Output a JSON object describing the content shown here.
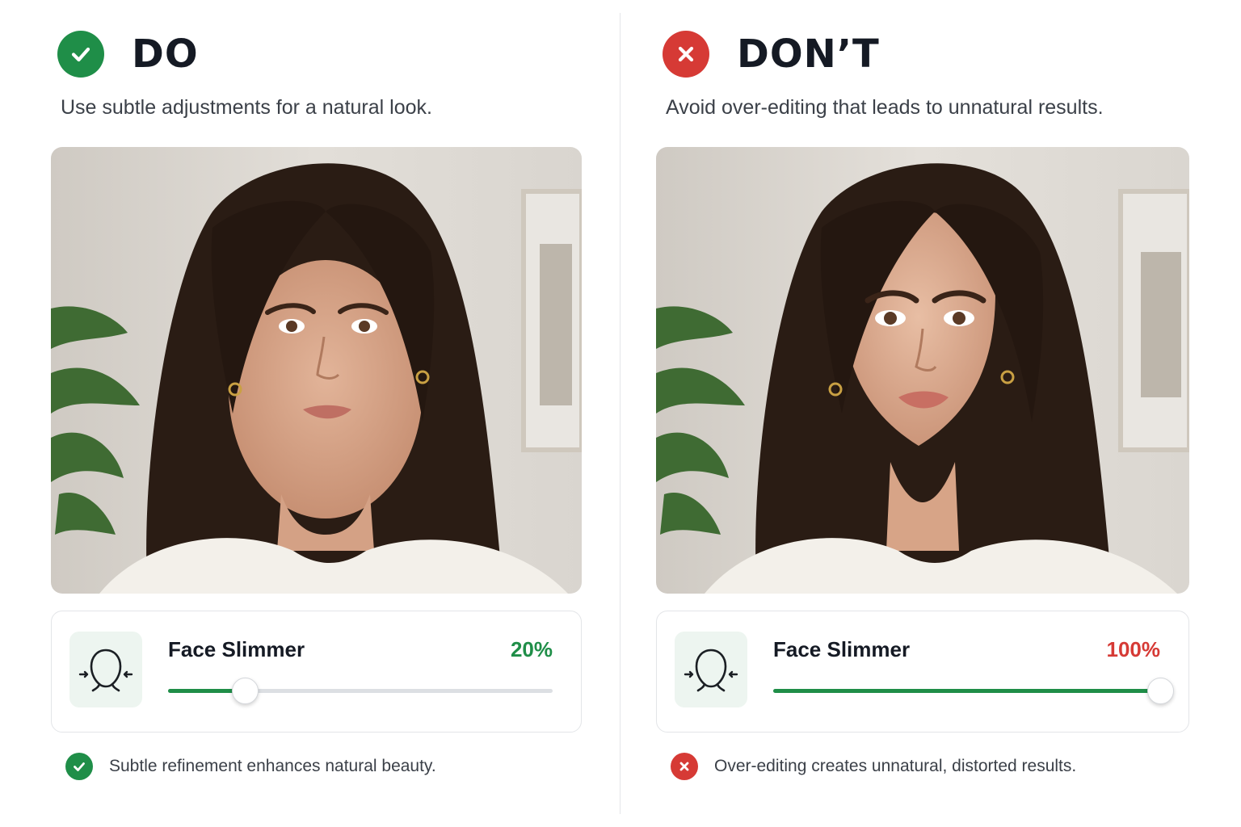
{
  "colors": {
    "good": "#1f8e48",
    "bad": "#d63a35",
    "track": "#dcdfe3"
  },
  "do_panel": {
    "heading": "DO",
    "heading_icon": "check-icon",
    "subtitle": "Use subtle adjustments for a natural look.",
    "photo": "portrait-photo-natural",
    "tool": {
      "icon": "face-slimmer-icon",
      "label": "Face Slimmer",
      "value_text": "20%",
      "level": 0.2
    },
    "note_icon": "check-icon",
    "note": "Subtle refinement enhances natural beauty."
  },
  "dont_panel": {
    "heading": "DON’T",
    "heading_icon": "close-icon",
    "subtitle": "Avoid over-editing that leads to unnatural results.",
    "photo": "portrait-photo-over-edited",
    "tool": {
      "icon": "face-slimmer-icon",
      "label": "Face Slimmer",
      "value_text": "100%",
      "level": 1.0
    },
    "note_icon": "close-icon",
    "note": "Over-editing creates unnatural, distorted results."
  }
}
